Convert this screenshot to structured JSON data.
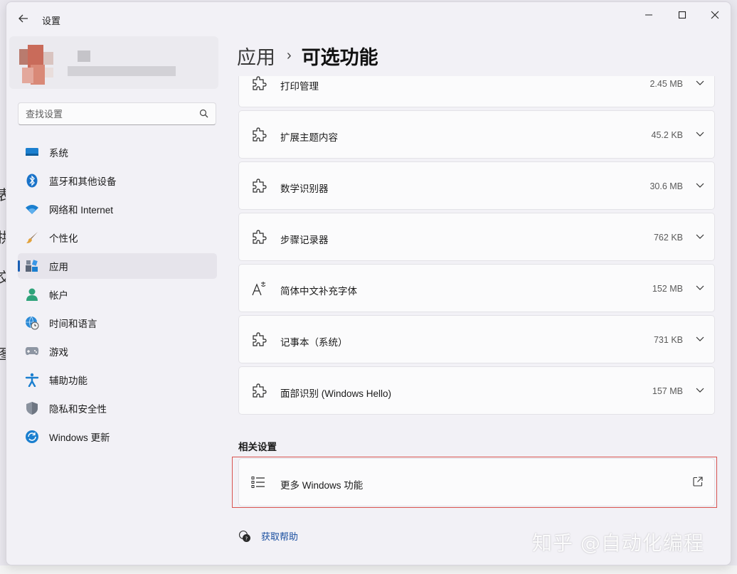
{
  "window": {
    "title": "设置"
  },
  "search": {
    "placeholder": "查找设置"
  },
  "sidebar": {
    "items": [
      {
        "label": "系统",
        "icon": "monitor-icon"
      },
      {
        "label": "蓝牙和其他设备",
        "icon": "bluetooth-icon"
      },
      {
        "label": "网络和 Internet",
        "icon": "wifi-icon"
      },
      {
        "label": "个性化",
        "icon": "brush-icon"
      },
      {
        "label": "应用",
        "icon": "apps-icon",
        "active": true
      },
      {
        "label": "帐户",
        "icon": "person-icon"
      },
      {
        "label": "时间和语言",
        "icon": "globe-clock-icon"
      },
      {
        "label": "游戏",
        "icon": "gamepad-icon"
      },
      {
        "label": "辅助功能",
        "icon": "accessibility-icon"
      },
      {
        "label": "隐私和安全性",
        "icon": "shield-icon"
      },
      {
        "label": "Windows 更新",
        "icon": "update-icon"
      }
    ]
  },
  "breadcrumb": {
    "parent": "应用",
    "separator": "›",
    "current": "可选功能"
  },
  "features": [
    {
      "name": "打印管理",
      "size": "2.45 MB",
      "icon": "puzzle-icon"
    },
    {
      "name": "扩展主题内容",
      "size": "45.2 KB",
      "icon": "puzzle-icon"
    },
    {
      "name": "数学识别器",
      "size": "30.6 MB",
      "icon": "puzzle-icon"
    },
    {
      "name": "步骤记录器",
      "size": "762 KB",
      "icon": "puzzle-icon"
    },
    {
      "name": "简体中文补充字体",
      "size": "152 MB",
      "icon": "font-icon"
    },
    {
      "name": "记事本（系统）",
      "size": "731 KB",
      "icon": "puzzle-icon"
    },
    {
      "name": "面部识别 (Windows Hello)",
      "size": "157 MB",
      "icon": "puzzle-icon"
    }
  ],
  "related": {
    "heading": "相关设置",
    "more_features": "更多 Windows 功能"
  },
  "help": {
    "label": "获取帮助"
  },
  "watermark": "知乎 @自动化编程",
  "colors": {
    "accent": "#1a5fb4",
    "highlight_border": "#d9534f",
    "link": "#1a4fa0"
  }
}
